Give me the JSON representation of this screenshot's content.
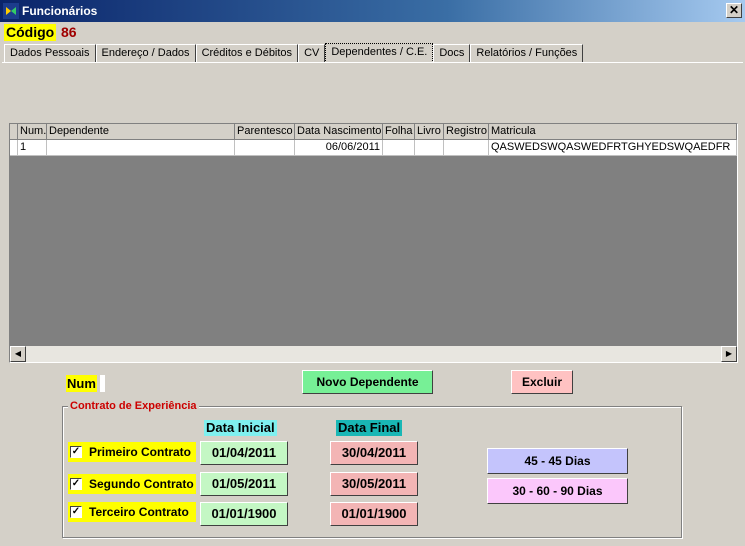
{
  "window": {
    "title": "Funcionários",
    "close_glyph": "✕"
  },
  "header": {
    "codigo_label": "Código",
    "codigo_value": "86"
  },
  "tabs": [
    {
      "label": "Dados Pessoais"
    },
    {
      "label": "Endereço / Dados"
    },
    {
      "label": "Créditos e Débitos"
    },
    {
      "label": "CV"
    },
    {
      "label": "Dependentes / C.E.",
      "active": true
    },
    {
      "label": "Docs"
    },
    {
      "label": "Relatórios / Funções"
    }
  ],
  "grid": {
    "columns": [
      "Num.",
      "Dependente",
      "Parentesco",
      "Data Nascimento",
      "Folha",
      "Livro",
      "Registro",
      "Matricula"
    ],
    "rows": [
      {
        "num": "1",
        "dependente": "",
        "parentesco": "",
        "data_nascimento": "06/06/2011",
        "folha": "",
        "livro": "",
        "registro": "",
        "matricula": "QASWEDSWQASWEDFRTGHYEDSWQAEDFR"
      }
    ],
    "scroll_left": "◀",
    "scroll_right": "▶"
  },
  "form": {
    "num_label": "Num",
    "num_value": "",
    "novo_dependente": "Novo Dependente",
    "excluir": "Excluir"
  },
  "contrato": {
    "legend": "Contrato de Experiência",
    "data_inicial_label": "Data Inicial",
    "data_final_label": "Data Final",
    "rows": [
      {
        "label": "Primeiro Contrato",
        "checked": true,
        "check_glyph": "✓",
        "data_inicial": "01/04/2011",
        "data_final": "30/04/2011"
      },
      {
        "label": "Segundo Contrato",
        "checked": true,
        "check_glyph": "✓",
        "data_inicial": "01/05/2011",
        "data_final": "30/05/2011"
      },
      {
        "label": "Terceiro Contrato",
        "checked": true,
        "check_glyph": "✓",
        "data_inicial": "01/01/1900",
        "data_final": "01/01/1900"
      }
    ],
    "btn_45": "45 - 45 Dias",
    "btn_30_60_90": "30 - 60 - 90 Dias"
  }
}
